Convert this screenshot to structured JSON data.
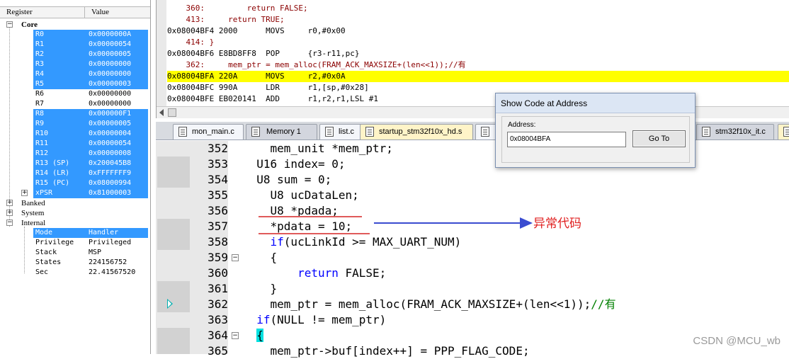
{
  "registers": {
    "header": {
      "name": "Register",
      "value": "Value"
    },
    "core_label": "Core",
    "core": [
      {
        "name": "R0",
        "value": "0x0000000A",
        "selected": true
      },
      {
        "name": "R1",
        "value": "0x00000054",
        "selected": true
      },
      {
        "name": "R2",
        "value": "0x00000005",
        "selected": true
      },
      {
        "name": "R3",
        "value": "0x00000000",
        "selected": true
      },
      {
        "name": "R4",
        "value": "0x00000000",
        "selected": true
      },
      {
        "name": "R5",
        "value": "0x00000003",
        "selected": true
      },
      {
        "name": "R6",
        "value": "0x00000000",
        "selected": false
      },
      {
        "name": "R7",
        "value": "0x00000000",
        "selected": false
      },
      {
        "name": "R8",
        "value": "0x000000F1",
        "selected": true
      },
      {
        "name": "R9",
        "value": "0x00000005",
        "selected": true
      },
      {
        "name": "R10",
        "value": "0x00000004",
        "selected": true
      },
      {
        "name": "R11",
        "value": "0x00000054",
        "selected": true
      },
      {
        "name": "R12",
        "value": "0x00000008",
        "selected": true
      },
      {
        "name": "R13 (SP)",
        "value": "0x200045B8",
        "selected": true
      },
      {
        "name": "R14 (LR)",
        "value": "0xFFFFFFF9",
        "selected": true
      },
      {
        "name": "R15 (PC)",
        "value": "0x08000994",
        "selected": true
      },
      {
        "name": "xPSR",
        "value": "0x81000003",
        "selected": true
      }
    ],
    "banked_label": "Banked",
    "system_label": "System",
    "internal_label": "Internal",
    "internal": [
      {
        "name": "Mode",
        "value": "Handler",
        "selected": true
      },
      {
        "name": "Privilege",
        "value": "Privileged",
        "selected": false
      },
      {
        "name": "Stack",
        "value": "MSP",
        "selected": false
      },
      {
        "name": "States",
        "value": "224156752",
        "selected": false
      },
      {
        "name": "Sec",
        "value": "22.41567520",
        "selected": false
      }
    ]
  },
  "disassembly": [
    {
      "text": "    360:         return FALSE;",
      "type": "src"
    },
    {
      "text": "    413:     return TRUE;",
      "type": "src"
    },
    {
      "text": "0x08004BF4 2000      MOVS     r0,#0x00",
      "type": "asm"
    },
    {
      "text": "    414: }",
      "type": "src"
    },
    {
      "text": "0x08004BF6 E8BD8FF8  POP      {r3-r11,pc}",
      "type": "asm"
    },
    {
      "text": "    362:     mem_ptr = mem_alloc(FRAM_ACK_MAXSIZE+(len<<1));//有",
      "type": "src"
    },
    {
      "text": "0x08004BFA 220A      MOVS     r2,#0x0A",
      "type": "hl"
    },
    {
      "text": "0x08004BFC 990A      LDR      r1,[sp,#0x28]",
      "type": "asm"
    },
    {
      "text": "0x08004BFE EB020141  ADD      r1,r2,r1,LSL #1",
      "type": "asm"
    }
  ],
  "tabs": [
    {
      "label": "mon_main.c"
    },
    {
      "label": "Memory 1"
    },
    {
      "label": "list.c"
    },
    {
      "label": "startup_stm32f10x_hd.s"
    },
    {
      "label": ""
    },
    {
      "label": "stm32f10x_it.c"
    },
    {
      "label": ""
    }
  ],
  "editor": [
    {
      "ln": "352",
      "fold": "",
      "parts": [
        [
          "",
          "    mem_unit *mem_ptr;"
        ]
      ]
    },
    {
      "ln": "353",
      "fold": "",
      "parts": [
        [
          "",
          "  U16 index= "
        ],
        [
          "num",
          "0"
        ],
        [
          "",
          ";"
        ]
      ]
    },
    {
      "ln": "354",
      "fold": "",
      "parts": [
        [
          "",
          "  U8 sum = "
        ],
        [
          "num",
          "0"
        ],
        [
          "",
          ";"
        ]
      ]
    },
    {
      "ln": "355",
      "fold": "",
      "parts": [
        [
          "",
          "    U8 ucDataLen;"
        ]
      ]
    },
    {
      "ln": "356",
      "fold": "",
      "parts": [
        [
          "",
          "    U8 *pdada;"
        ]
      ]
    },
    {
      "ln": "357",
      "fold": "",
      "parts": [
        [
          "",
          "    *pdata = "
        ],
        [
          "num",
          "10"
        ],
        [
          "",
          ";"
        ]
      ]
    },
    {
      "ln": "358",
      "fold": "",
      "parts": [
        [
          "",
          "    "
        ],
        [
          "kw",
          "if"
        ],
        [
          "",
          "(ucLinkId >= MAX_UART_NUM)"
        ]
      ]
    },
    {
      "ln": "359",
      "fold": "−",
      "parts": [
        [
          "",
          "    {"
        ]
      ]
    },
    {
      "ln": "360",
      "fold": "",
      "parts": [
        [
          "",
          "        "
        ],
        [
          "kw",
          "return"
        ],
        [
          "",
          " FALSE;"
        ]
      ]
    },
    {
      "ln": "361",
      "fold": "",
      "parts": [
        [
          "",
          "    }"
        ]
      ]
    },
    {
      "ln": "362",
      "fold": "",
      "parts": [
        [
          "",
          "    mem_ptr = mem_alloc(FRAM_ACK_MAXSIZE+(len<<"
        ],
        [
          "num",
          "1"
        ],
        [
          "",
          "));"
        ],
        [
          "cmt",
          "//有"
        ]
      ]
    },
    {
      "ln": "363",
      "fold": "",
      "parts": [
        [
          "",
          "  "
        ],
        [
          "kw",
          "if"
        ],
        [
          "",
          "(NULL != mem_ptr)"
        ]
      ]
    },
    {
      "ln": "364",
      "fold": "−",
      "parts": [
        [
          "",
          "  "
        ],
        [
          "brace",
          "{"
        ]
      ]
    },
    {
      "ln": "365",
      "fold": "",
      "parts": [
        [
          "",
          "    mem_ptr->buf[index++] = PPP_FLAG_CODE;"
        ]
      ]
    }
  ],
  "annotation": "异常代码",
  "watermark": "CSDN @MCU_wb",
  "dialog": {
    "title": "Show Code at Address",
    "address_label": "Address:",
    "address_value": "0x08004BFA",
    "goto_label": "Go To"
  },
  "colors": {
    "selection": "#3399ff",
    "highlight": "#ffff00",
    "keyword": "#0000ff",
    "comment": "#008000",
    "source_line": "#8b0000",
    "annotation": "#e02020",
    "arrow": "#3a4cd0"
  }
}
